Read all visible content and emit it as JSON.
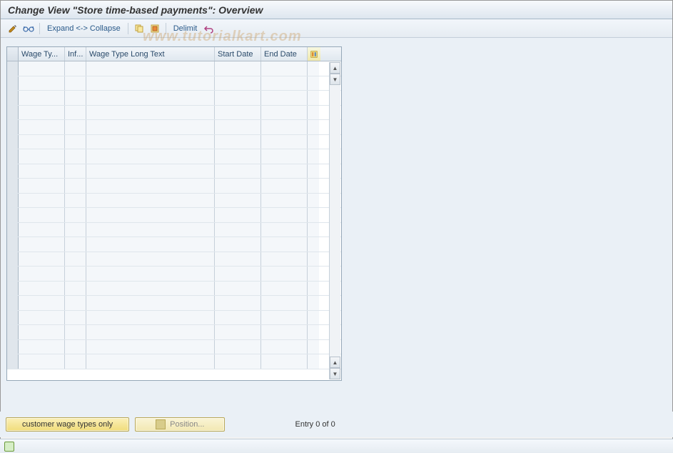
{
  "title": "Change View \"Store time-based payments\": Overview",
  "toolbar": {
    "expand_collapse": "Expand <-> Collapse",
    "delimit": "Delimit"
  },
  "table": {
    "columns": {
      "wage_type": "Wage Ty...",
      "inf": "Inf...",
      "wage_type_long": "Wage Type Long Text",
      "start_date": "Start Date",
      "end_date": "End Date"
    },
    "rows": [
      {
        "wage_type": "",
        "inf": "",
        "long": "",
        "start": "",
        "end": ""
      },
      {
        "wage_type": "",
        "inf": "",
        "long": "",
        "start": "",
        "end": ""
      },
      {
        "wage_type": "",
        "inf": "",
        "long": "",
        "start": "",
        "end": ""
      },
      {
        "wage_type": "",
        "inf": "",
        "long": "",
        "start": "",
        "end": ""
      },
      {
        "wage_type": "",
        "inf": "",
        "long": "",
        "start": "",
        "end": ""
      },
      {
        "wage_type": "",
        "inf": "",
        "long": "",
        "start": "",
        "end": ""
      },
      {
        "wage_type": "",
        "inf": "",
        "long": "",
        "start": "",
        "end": ""
      },
      {
        "wage_type": "",
        "inf": "",
        "long": "",
        "start": "",
        "end": ""
      },
      {
        "wage_type": "",
        "inf": "",
        "long": "",
        "start": "",
        "end": ""
      },
      {
        "wage_type": "",
        "inf": "",
        "long": "",
        "start": "",
        "end": ""
      },
      {
        "wage_type": "",
        "inf": "",
        "long": "",
        "start": "",
        "end": ""
      },
      {
        "wage_type": "",
        "inf": "",
        "long": "",
        "start": "",
        "end": ""
      },
      {
        "wage_type": "",
        "inf": "",
        "long": "",
        "start": "",
        "end": ""
      },
      {
        "wage_type": "",
        "inf": "",
        "long": "",
        "start": "",
        "end": ""
      },
      {
        "wage_type": "",
        "inf": "",
        "long": "",
        "start": "",
        "end": ""
      },
      {
        "wage_type": "",
        "inf": "",
        "long": "",
        "start": "",
        "end": ""
      },
      {
        "wage_type": "",
        "inf": "",
        "long": "",
        "start": "",
        "end": ""
      },
      {
        "wage_type": "",
        "inf": "",
        "long": "",
        "start": "",
        "end": ""
      },
      {
        "wage_type": "",
        "inf": "",
        "long": "",
        "start": "",
        "end": ""
      },
      {
        "wage_type": "",
        "inf": "",
        "long": "",
        "start": "",
        "end": ""
      },
      {
        "wage_type": "",
        "inf": "",
        "long": "",
        "start": "",
        "end": ""
      }
    ]
  },
  "footer": {
    "customer_btn": "customer wage types only",
    "position_btn": "Position...",
    "entry_text": "Entry 0 of 0"
  },
  "watermark": "www.tutorialkart.com",
  "icons": {
    "edit": "pencil-icon",
    "glasses": "glasses-icon",
    "copy": "copy-icon",
    "select_all": "select-all-icon",
    "undo": "undo-icon",
    "config": "config-icon"
  }
}
